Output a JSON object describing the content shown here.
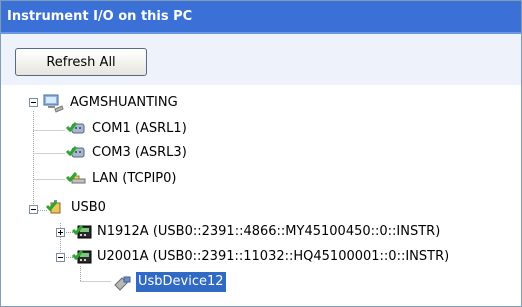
{
  "panel": {
    "title": "Instrument I/O on this PC"
  },
  "toolbar": {
    "refresh_label": "Refresh All"
  },
  "tree": {
    "root": {
      "label": "AGMSHUANTING",
      "icon": "computer-icon",
      "expanded": true
    },
    "interfaces": [
      {
        "label": "COM1 (ASRL1)",
        "icon": "serial-port-icon"
      },
      {
        "label": "COM3 (ASRL3)",
        "icon": "serial-port-icon"
      },
      {
        "label": "LAN (TCPIP0)",
        "icon": "lan-icon"
      },
      {
        "label": "USB0",
        "icon": "usb-interface-icon",
        "expanded": true
      }
    ],
    "usb_devices": [
      {
        "label": "N1912A (USB0::2391::4866::MY45100450::0::INSTR)",
        "icon": "instrument-icon",
        "expanded": false
      },
      {
        "label": "U2001A (USB0::2391::11032::HQ45100001::0::INSTR)",
        "icon": "instrument-icon",
        "expanded": true
      }
    ],
    "u2001a_child": {
      "label": "UsbDevice12",
      "icon": "usb-device-icon",
      "selected": true
    }
  },
  "colors": {
    "header": "#3b70d6",
    "selection": "#316ac5",
    "tree_line": "#a0a0a0",
    "ok_check": "#2ea52e"
  }
}
